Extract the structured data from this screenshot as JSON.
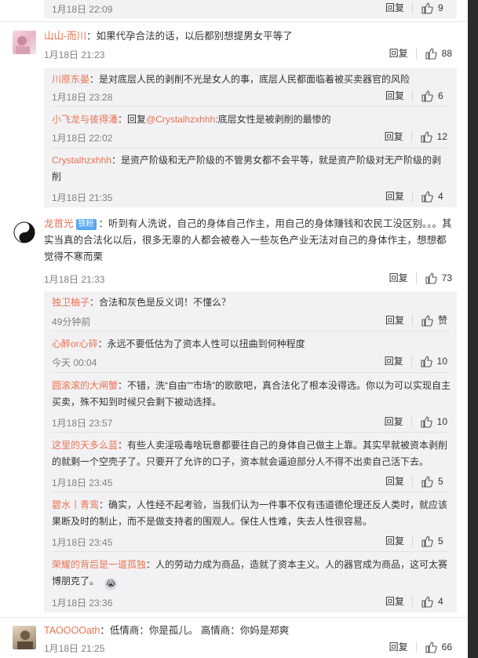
{
  "ui": {
    "reply_label": "回复",
    "reply_prefix": "回复"
  },
  "top_row": {
    "time": "1月18日 22:09",
    "likes": "9"
  },
  "comments": [
    {
      "user": "山山-而川",
      "text": "：如果代孕合法的话，以后都别想提男女平等了",
      "time": "1月18日 21:23",
      "likes": "88",
      "replies": [
        {
          "user": "川原东晏",
          "text": "：是对底层人民的剥削不光是女人的事，底层人民都面临着被买卖器官的风险",
          "time": "1月18日 23:28",
          "likes": "6"
        },
        {
          "user": "小飞龙与彼得潘",
          "mention": "@Crystalhzxhhh",
          "text": ":底层女性是被剥削的最惨的",
          "time": "1月18日 22:02",
          "likes": "12"
        },
        {
          "user": "Crystalhzxhhh",
          "text": "：是资产阶级和无产阶级的不管男女都不会平等，就是资产阶级对无产阶级的剥削",
          "time": "1月18日 21:35",
          "likes": "4"
        }
      ]
    },
    {
      "user": "龙首光",
      "badge": "铁粉",
      "text": "：听到有人洗说，自己的身体自己作主，用自己的身体赚钱和农民工没区别。。。其实当真的合法化以后，很多无辜的人都会被卷入一些灰色产业无法对自己的身体作主，想想都觉得不寒而栗",
      "time": "1月18日 21:33",
      "likes": "73",
      "replies": [
        {
          "user": "独卫柚子",
          "text": "：合法和灰色是反义词！不懂么？",
          "time": "49分钟前",
          "likes": "赞"
        },
        {
          "user": "心醉or心碎",
          "text": "：永远不要低估为了资本人性可以扭曲到何种程度",
          "time": "今天 00:04",
          "likes": "10"
        },
        {
          "user": "圆滚滚的大闸蟹",
          "text": "：不错，洗“自由”“市场”的歌歌吧，真合法化了根本没得选。你以为可以实现自主买卖，殊不知到时候只会剩下被动选择。",
          "time": "1月18日 23:57",
          "likes": "10"
        },
        {
          "user": "这里的天多么蓝",
          "text": "：有些人卖淫吸毒啥玩意都要往自己的身体自己做主上靠。其实早就被资本剥削的就剩一个空壳子了。只要开了允许的口子，资本就会逼迫部分人不得不出卖自己活下去。",
          "time": "1月18日 23:45",
          "likes": "5"
        },
        {
          "user": "碧水丨青鸾",
          "text": "：确实，人性经不起考验，当我们认为一件事不仅有违道德伦理还反人类时，就应该果断及时的制止，而不是做支持者的围观人。保住人性难，失去人性很容易。",
          "time": "1月18日 23:45",
          "likes": "5"
        },
        {
          "user": "荣耀的背后是一道孤独",
          "text": "：人的劳动力成为商品，造就了资本主义。人的器官成为商品，这可太赛博朋克了。",
          "time": "1月18日 23:36",
          "likes": "4"
        }
      ]
    },
    {
      "user": "TAOOOOath",
      "text": "：低情商：你是孤儿。 高情商：你妈是郑爽",
      "time": "1月18日 21:25",
      "likes": "66",
      "replies": []
    }
  ],
  "icons": {
    "thumb": "thumb-up-icon"
  },
  "colors": {
    "username": "#eb7350",
    "reply_bg": "#f2f2f5",
    "meta": "#808080",
    "badge": "#5aa9f3"
  }
}
